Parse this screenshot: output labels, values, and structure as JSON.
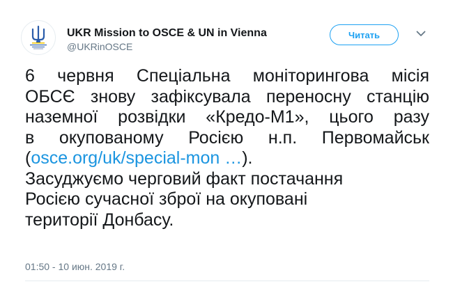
{
  "account": {
    "name": "UKR Mission to OSCE & UN in Vienna",
    "handle": "@UKRinOSCE",
    "avatar_icon": "ukrainian-trident-emblem-icon"
  },
  "actions": {
    "follow_label": "Читать",
    "menu_icon": "chevron-down-icon"
  },
  "tweet": {
    "line1": "6 червня Спеціальна моніторингова місія",
    "line2": "ОБСЄ знову зафіксувала переносну станцію",
    "line3": "наземної розвідки «Кредо-М1», цього разу",
    "line4": "в окупованому Росією н.п. Первомайськ",
    "paren_open": "(",
    "link_text": "osce.org/uk/special-mon …",
    "paren_close": ").",
    "line6": "Засуджуємо черговий факт постачання",
    "line7": "Росією сучасної зброї на окуповані",
    "line8": "території Донбасу."
  },
  "timestamp": "01:50 - 10 июн. 2019 г.",
  "colors": {
    "accent": "#1da1f2",
    "link": "#1b95e0",
    "text": "#14171a",
    "secondary": "#657786",
    "trident_blue": "#2a5caa",
    "trident_gold": "#f2c300"
  }
}
